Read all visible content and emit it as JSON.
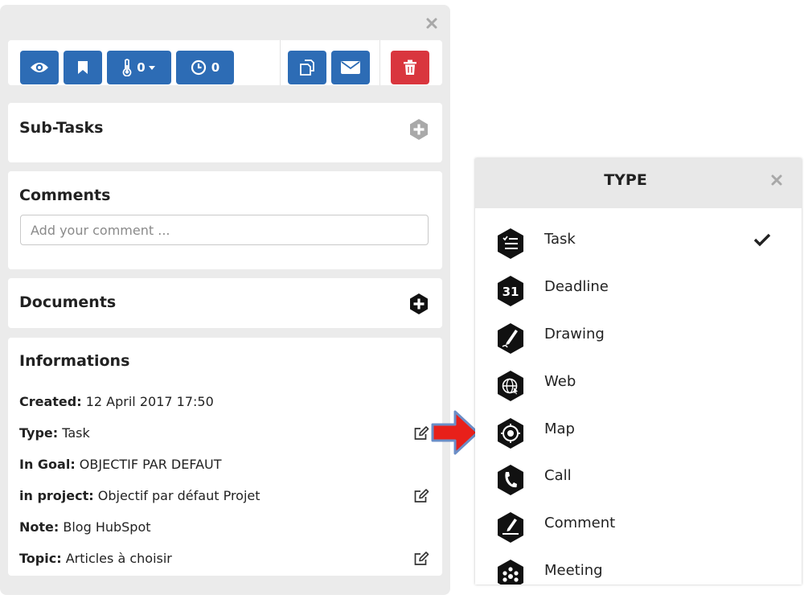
{
  "toolbar": {
    "thermometer_count": "0",
    "timer_count": "0",
    "colors": {
      "primary": "#2d6cb5",
      "danger": "#d9363e"
    }
  },
  "subtasks": {
    "title": "Sub-Tasks"
  },
  "comments": {
    "title": "Comments",
    "placeholder": "Add your comment ..."
  },
  "documents": {
    "title": "Documents"
  },
  "informations": {
    "title": "Informations",
    "rows": [
      {
        "label": "Created:",
        "value": " 12 April 2017 17:50"
      },
      {
        "label": "Type:",
        "value": " Task"
      },
      {
        "label": "In Goal:",
        "value": " OBJECTIF PAR DEFAUT"
      },
      {
        "label": "in project:",
        "value": " Objectif par défaut Projet"
      },
      {
        "label": "Note:",
        "value": " Blog HubSpot"
      },
      {
        "label": "Topic:",
        "value": " Articles à choisir"
      }
    ]
  },
  "type_picker": {
    "title": "TYPE",
    "selected": "Task",
    "items": [
      {
        "label": "Task",
        "icon": "task-list-icon"
      },
      {
        "label": "Deadline",
        "icon": "calendar-31-icon"
      },
      {
        "label": "Drawing",
        "icon": "pencil-icon"
      },
      {
        "label": "Web",
        "icon": "globe-icon"
      },
      {
        "label": "Map",
        "icon": "target-icon"
      },
      {
        "label": "Call",
        "icon": "phone-icon"
      },
      {
        "label": "Comment",
        "icon": "pen-line-icon"
      },
      {
        "label": "Meeting",
        "icon": "meeting-icon"
      }
    ]
  },
  "arrow_color": "#e8201a"
}
